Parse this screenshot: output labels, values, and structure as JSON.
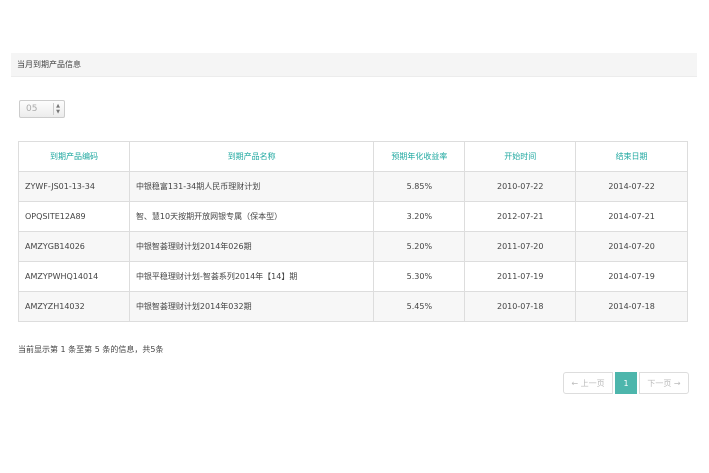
{
  "panel": {
    "title": "当月到期产品信息"
  },
  "page_size": {
    "value": "05"
  },
  "table": {
    "headers": [
      "到期产品编码",
      "到期产品名称",
      "预期年化收益率",
      "开始时间",
      "结束日期"
    ],
    "rows": [
      [
        "ZYWF-JS01-13-34",
        "中银稳富131-34期人民币理财计划",
        "5.85%",
        "2010-07-22",
        "2014-07-22"
      ],
      [
        "OPQSITE12A89",
        "智、慧10天按期开放网银专属（保本型）",
        "3.20%",
        "2012-07-21",
        "2014-07-21"
      ],
      [
        "AMZYGB14026",
        "中银智荟理财计划2014年026期",
        "5.20%",
        "2011-07-20",
        "2014-07-20"
      ],
      [
        "AMZYPWHQ14014",
        "中银平稳理财计划-智荟系列2014年【14】期",
        "5.30%",
        "2011-07-19",
        "2014-07-19"
      ],
      [
        "AMZYZH14032",
        "中银智荟理财计划2014年032期",
        "5.45%",
        "2010-07-18",
        "2014-07-18"
      ]
    ]
  },
  "info": "当前显示第 1 条至第 5 条的信息，共5条",
  "pagination": {
    "prev": "← 上一页",
    "current": "1",
    "next": "下一页 →"
  }
}
